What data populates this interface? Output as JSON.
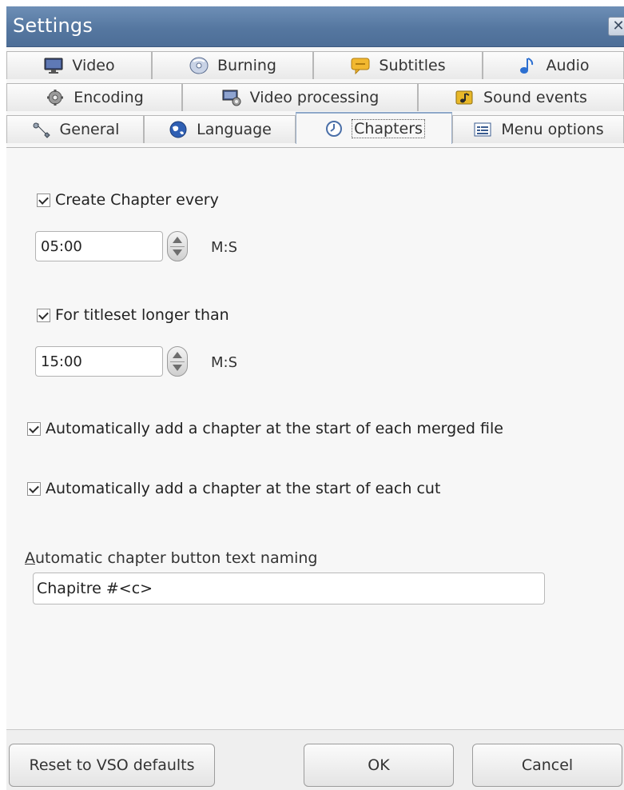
{
  "window": {
    "title": "Settings",
    "close_glyph": "✕"
  },
  "tabs": {
    "row1": [
      {
        "label": "Video",
        "icon": "monitor-icon"
      },
      {
        "label": "Burning",
        "icon": "disc-icon"
      },
      {
        "label": "Subtitles",
        "icon": "subtitle-bubble-icon"
      },
      {
        "label": "Audio",
        "icon": "music-note-icon"
      }
    ],
    "row2": [
      {
        "label": "Encoding",
        "icon": "gear-icon"
      },
      {
        "label": "Video processing",
        "icon": "video-processing-icon"
      },
      {
        "label": "Sound events",
        "icon": "sound-events-icon"
      }
    ],
    "row3": [
      {
        "label": "General",
        "icon": "wrench-icon"
      },
      {
        "label": "Language",
        "icon": "globe-icon"
      },
      {
        "label": "Chapters",
        "icon": "clock-icon",
        "active": true
      },
      {
        "label": "Menu options",
        "icon": "menu-list-icon"
      }
    ]
  },
  "chapters": {
    "create_every": {
      "label": "Create Chapter every",
      "checked": true,
      "value": "05:00",
      "unit": "M:S"
    },
    "titleset_longer": {
      "label": "For titleset longer than",
      "checked": true,
      "value": "15:00",
      "unit": "M:S"
    },
    "merged_file": {
      "label": "Automatically add a chapter at the start of each merged file",
      "checked": true
    },
    "each_cut": {
      "label": "Automatically add a chapter at the start of each cut",
      "checked": true
    },
    "naming": {
      "label_first": "A",
      "label_rest": "utomatic chapter button text naming",
      "value": "Chapitre #<c>"
    }
  },
  "buttons": {
    "reset": "Reset to VSO defaults",
    "ok": "OK",
    "cancel": "Cancel"
  },
  "colors": {
    "titlebar": "#5577a0",
    "active_tab_border": "#8ea8c9"
  }
}
